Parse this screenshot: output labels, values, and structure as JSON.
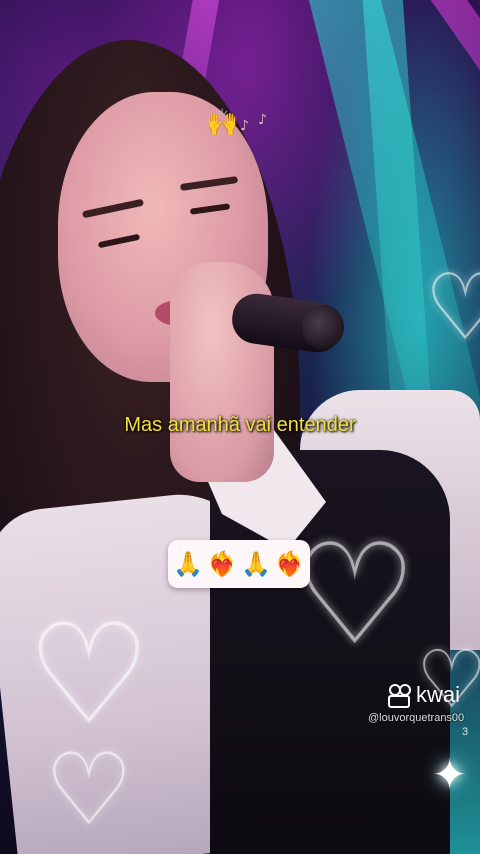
{
  "overlay": {
    "top_emoji": "🙌",
    "notes": [
      "♪",
      "♪"
    ],
    "lyric": "Mas amanhã vai entender",
    "emoji_row": [
      "🙏",
      "❤️‍🔥",
      "🙏",
      "❤️‍🔥"
    ]
  },
  "watermark": {
    "brand": "kwai",
    "handle": "@louvorquetrans00",
    "handle_suffix": "3"
  },
  "decor": {
    "hearts": [
      "♡",
      "♡",
      "♡",
      "♡",
      "♡"
    ],
    "sparkle": "✦"
  },
  "colors": {
    "lyric": "#f3e03a",
    "beam_cyan": "#28e6dc",
    "beam_magenta": "#dc3cdc"
  }
}
